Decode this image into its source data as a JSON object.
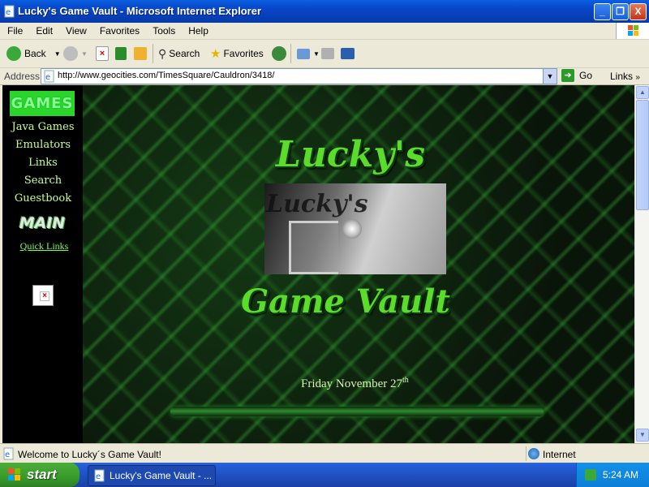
{
  "window": {
    "title": "Lucky's Game Vault - Microsoft Internet Explorer",
    "min_label": "_",
    "max_label": "❐",
    "close_label": "X"
  },
  "menu": [
    "File",
    "Edit",
    "View",
    "Favorites",
    "Tools",
    "Help"
  ],
  "toolbar": {
    "back_label": "Back",
    "search_label": "Search",
    "favorites_label": "Favorites"
  },
  "address": {
    "label": "Address",
    "url": "http://www.geocities.com/TimesSquare/Cauldron/3418/",
    "go_label": "Go",
    "links_label": "Links"
  },
  "sidebar": {
    "header": "GAMES",
    "links": [
      "Java Games",
      "Emulators",
      "Links",
      "Search",
      "Guestbook"
    ],
    "main_label": "MAIN",
    "quick_links": "Quick Links"
  },
  "page": {
    "logo_top": "Lucky's",
    "vault_text": "Lucky's",
    "logo_bottom": "Game Vault",
    "date_text": "Friday November 27",
    "date_suffix": "th"
  },
  "status": {
    "text": "Welcome to Lucky´s Game Vault!",
    "zone": "Internet"
  },
  "taskbar": {
    "start_label": "start",
    "task_label": "Lucky's Game Vault - ...",
    "clock": "5:24 AM"
  },
  "colors": {
    "accent_green": "#5bdc2a",
    "titlebar_blue": "#0845c8"
  }
}
